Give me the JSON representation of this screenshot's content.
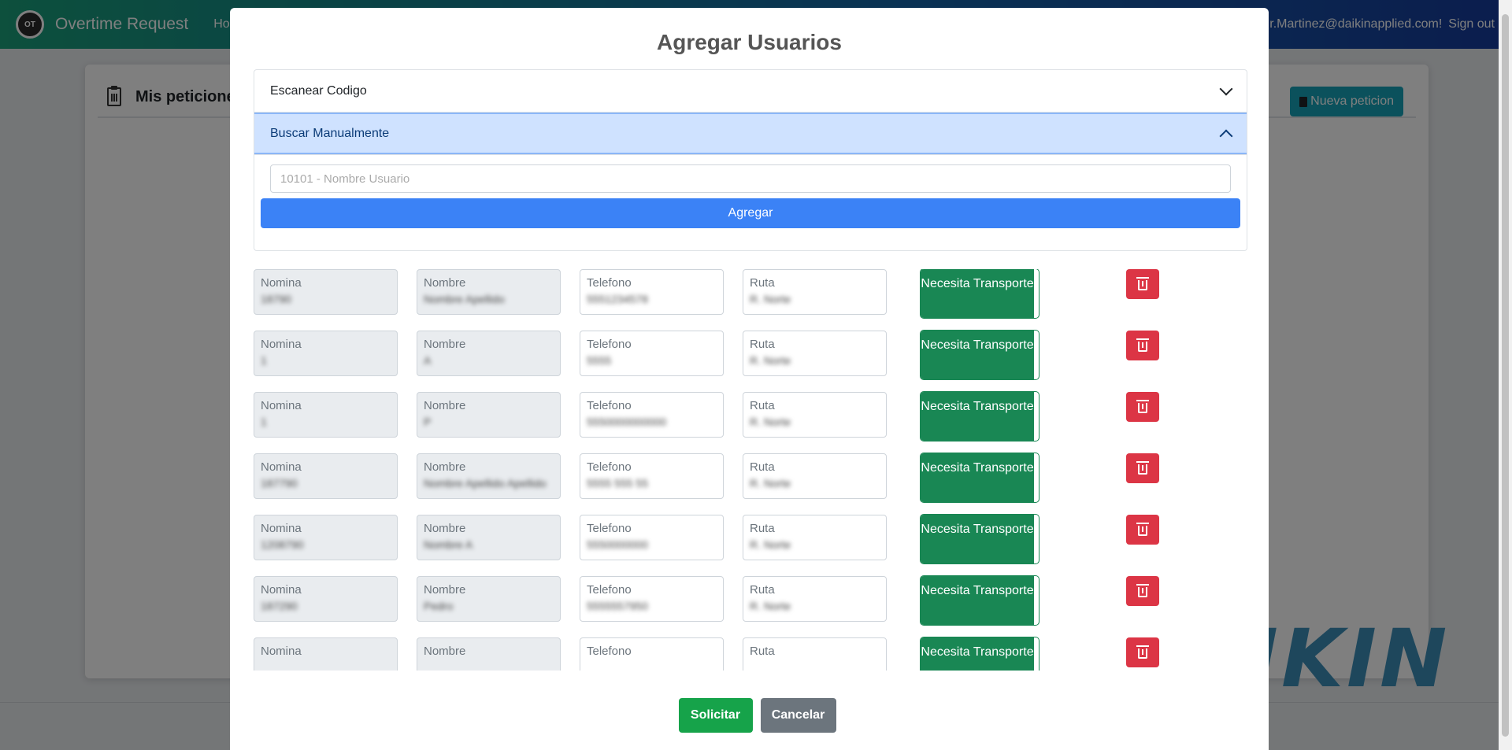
{
  "navbar": {
    "logo_text": "OT",
    "title": "Overtime Request",
    "home_label": "Hom",
    "user_email": "r.Martinez@daikinapplied.com!",
    "signout_label": "Sign out"
  },
  "page": {
    "card_title": "Mis peticiones",
    "new_request_label": "Nueva peticion",
    "watermark_text": "IKIN"
  },
  "modal": {
    "title": "Agregar Usuarios",
    "accordion": {
      "scan_label": "Escanear Codigo",
      "manual_label": "Buscar Manualmente"
    },
    "search": {
      "value": "10101 - Nombre Usuario"
    },
    "add_label": "Agregar",
    "field_labels": {
      "nomina": "Nomina",
      "nombre": "Nombre",
      "telefono": "Telefono",
      "ruta": "Ruta"
    },
    "transport_label": "Necesita Transporte",
    "rows": [
      {
        "nomina": "18790",
        "nombre": "Nombre Apellido",
        "telefono": "5551234578",
        "ruta": "R. Norte"
      },
      {
        "nomina": "1",
        "nombre": "A",
        "telefono": "5555",
        "ruta": "R. Norte"
      },
      {
        "nomina": "1",
        "nombre": "P",
        "telefono": "5550000000000",
        "ruta": "R. Norte"
      },
      {
        "nomina": "187790",
        "nombre": "Nombre Apellido Apellido",
        "telefono": "5555 555 55",
        "ruta": "R. Norte"
      },
      {
        "nomina": "1208790",
        "nombre": "Nombre A",
        "telefono": "5550000000",
        "ruta": "R. Norte"
      },
      {
        "nomina": "187290",
        "nombre": "Pedro",
        "telefono": "5555557950",
        "ruta": "R. Norte"
      },
      {
        "nomina": "",
        "nombre": "",
        "telefono": "",
        "ruta": ""
      }
    ],
    "submit_label": "Solicitar",
    "cancel_label": "Cancelar"
  },
  "colors": {
    "primary": "#3b82f6",
    "success": "#198754",
    "danger": "#dc3545",
    "secondary": "#6c757d",
    "accordion_active": "#cfe2ff"
  }
}
